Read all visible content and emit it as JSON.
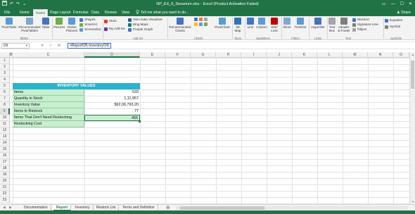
{
  "window": {
    "title": "NP_EX_6_Sexarium.xlsx - Excel (Product Activation Failed)",
    "qat": {
      "save": "save-icon",
      "undo": "↶",
      "redo": "↷",
      "more": "⌄"
    },
    "controls": {
      "options": "▭",
      "minimize": "—",
      "maximize": "☐",
      "close": "✕"
    }
  },
  "ribbon_tabs": [
    {
      "label": "File"
    },
    {
      "label": "Home"
    },
    {
      "label": "Insert",
      "active": true
    },
    {
      "label": "Page Layout"
    },
    {
      "label": "Formulas"
    },
    {
      "label": "Data"
    },
    {
      "label": "Review"
    },
    {
      "label": "View"
    }
  ],
  "tell_me": "Tell me what you want to do...",
  "share": "Share",
  "ribbon": {
    "tables": {
      "pivot": "PivotTable",
      "recommended": "Recommended\nPivotTables",
      "table": "Table",
      "group": "Tables"
    },
    "illustrations": {
      "pictures": "Pictures",
      "online": "Online\nPictures",
      "shapes": "Shapes",
      "smartart": "SmartArt",
      "screenshot": "Screenshot"
    },
    "addins": {
      "store": "Store",
      "my_addins": "My Add-ins",
      "visio": "Visio Data Visualizer",
      "bing": "Bing Maps",
      "people": "People Graph",
      "group": "Add-ins"
    },
    "charts": {
      "recommended": "Recommended\nCharts",
      "pivotchart": "PivotChart",
      "group": "Charts"
    },
    "tours": {
      "map3d": "3D\nMap",
      "group": "Tours"
    },
    "sparklines": {
      "line": "Line",
      "column": "Column",
      "winloss": "Win/\nLoss",
      "group": "Sparklines"
    },
    "filters": {
      "slicer": "Slicer",
      "timeline": "Timeline",
      "group": "Filters"
    },
    "links": {
      "hyperlink": "Hyperlink",
      "group": "Links"
    },
    "text": {
      "textbox": "Text\nBox",
      "headerfooter": "Header\n& Footer",
      "wordart": "WordArt",
      "signature": "Signature Line",
      "object": "Object",
      "group": "Text"
    },
    "symbols": {
      "equation": "Equation",
      "symbol": "Symbol",
      "group": "Symbols"
    }
  },
  "formula_bar": {
    "name_box": "D9",
    "cancel": "✕",
    "enter": "✓",
    "fx": "fx",
    "formula": "=Report!D5-Inventory!D8"
  },
  "columns": [
    "B",
    "C",
    "D",
    "E",
    "F",
    "G",
    "H",
    "I",
    "J",
    "K",
    "L",
    "M",
    "N",
    "O",
    "P"
  ],
  "selected_column": "D",
  "rows": [
    "1",
    "2",
    "3",
    "4",
    "5",
    "6",
    "7",
    "8",
    "9",
    "10",
    "11",
    "12",
    "13",
    "14",
    "15",
    "16",
    "17",
    "18",
    "19",
    "20",
    "21",
    "22",
    "23"
  ],
  "selected_row": "9",
  "inventory": {
    "header": "INVENTORY VALUES",
    "rows": [
      {
        "label": "Items",
        "value": "533"
      },
      {
        "label": "Quantity in Stock",
        "value": "1,11,957"
      },
      {
        "label": "Inventory Value",
        "value": "$92,06,793.20"
      },
      {
        "label": "Items to Restock",
        "value": "77"
      },
      {
        "label": "Items That Don't Need Restocking",
        "value": "456"
      },
      {
        "label": "Restocking Cost",
        "value": ""
      }
    ]
  },
  "sheets": [
    {
      "label": "Documentation"
    },
    {
      "label": "Report",
      "active": true
    },
    {
      "label": "Inventory"
    },
    {
      "label": "Restock List"
    },
    {
      "label": "Terms and Definition"
    }
  ],
  "sheet_nav": {
    "prev": "◀",
    "next": "▶",
    "add": "⊕"
  },
  "colors": {
    "excel_green": "#217346",
    "header_fill": "#2ab3cc",
    "label_fill": "#c6efce"
  }
}
